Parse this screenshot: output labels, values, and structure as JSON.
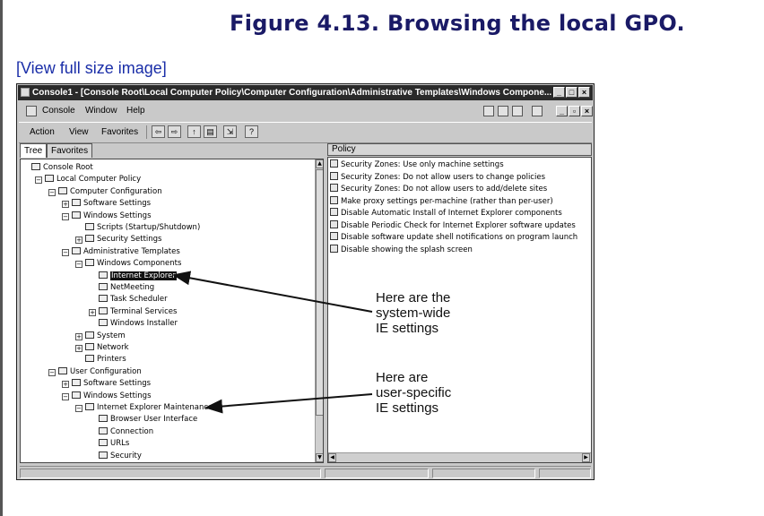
{
  "caption": "Figure 4.13. Browsing the local GPO.",
  "full_size_link": "[View full size image]",
  "window": {
    "title": "Console1 - [Console Root\\Local Computer Policy\\Computer Configuration\\Administrative Templates\\Windows Compone...",
    "menubar": [
      "Console",
      "Window",
      "Help"
    ],
    "toolbar": [
      "Action",
      "View",
      "Favorites"
    ],
    "tabs": [
      "Tree",
      "Favorites"
    ],
    "policy_header": "Policy"
  },
  "tree": [
    {
      "label": "Console Root",
      "depth": 0,
      "icon": "folder-icon"
    },
    {
      "label": "Local Computer Policy",
      "depth": 1,
      "icon": "policy-icon",
      "expander": "-"
    },
    {
      "label": "Computer Configuration",
      "depth": 2,
      "icon": "computer-icon",
      "expander": "-"
    },
    {
      "label": "Software Settings",
      "depth": 3,
      "icon": "folder-icon",
      "expander": "+"
    },
    {
      "label": "Windows Settings",
      "depth": 3,
      "icon": "folder-icon",
      "expander": "-"
    },
    {
      "label": "Scripts (Startup/Shutdown)",
      "depth": 4,
      "icon": "script-icon"
    },
    {
      "label": "Security Settings",
      "depth": 4,
      "icon": "security-icon",
      "expander": "+"
    },
    {
      "label": "Administrative Templates",
      "depth": 3,
      "icon": "folder-icon",
      "expander": "-"
    },
    {
      "label": "Windows Components",
      "depth": 4,
      "icon": "folder-icon",
      "expander": "-"
    },
    {
      "label": "Internet Explorer",
      "depth": 5,
      "icon": "folder-icon",
      "selected": true
    },
    {
      "label": "NetMeeting",
      "depth": 5,
      "icon": "folder-icon"
    },
    {
      "label": "Task Scheduler",
      "depth": 5,
      "icon": "folder-icon"
    },
    {
      "label": "Terminal Services",
      "depth": 5,
      "icon": "folder-icon",
      "expander": "+"
    },
    {
      "label": "Windows Installer",
      "depth": 5,
      "icon": "folder-icon"
    },
    {
      "label": "System",
      "depth": 4,
      "icon": "folder-icon",
      "expander": "+"
    },
    {
      "label": "Network",
      "depth": 4,
      "icon": "folder-icon",
      "expander": "+"
    },
    {
      "label": "Printers",
      "depth": 4,
      "icon": "folder-icon"
    },
    {
      "label": "User Configuration",
      "depth": 2,
      "icon": "user-icon",
      "expander": "-"
    },
    {
      "label": "Software Settings",
      "depth": 3,
      "icon": "folder-icon",
      "expander": "+"
    },
    {
      "label": "Windows Settings",
      "depth": 3,
      "icon": "folder-icon",
      "expander": "-"
    },
    {
      "label": "Internet Explorer Maintenance",
      "depth": 4,
      "icon": "ie-maintenance-icon",
      "expander": "-"
    },
    {
      "label": "Browser User Interface",
      "depth": 5,
      "icon": "browser-ui-icon"
    },
    {
      "label": "Connection",
      "depth": 5,
      "icon": "connection-icon"
    },
    {
      "label": "URLs",
      "depth": 5,
      "icon": "urls-icon"
    },
    {
      "label": "Security",
      "depth": 5,
      "icon": "security-icon"
    }
  ],
  "policies": [
    "Security Zones: Use only machine settings",
    "Security Zones: Do not allow users to change policies",
    "Security Zones: Do not allow users to add/delete sites",
    "Make proxy settings per-machine (rather than per-user)",
    "Disable Automatic Install of Internet Explorer components",
    "Disable Periodic Check for Internet Explorer software updates",
    "Disable software update shell notifications on program launch",
    "Disable showing the splash screen"
  ],
  "annotations": {
    "system_wide": [
      "Here are the",
      "system-wide",
      "IE settings"
    ],
    "user_specific": [
      "Here are",
      "user-specific",
      "IE settings"
    ]
  }
}
